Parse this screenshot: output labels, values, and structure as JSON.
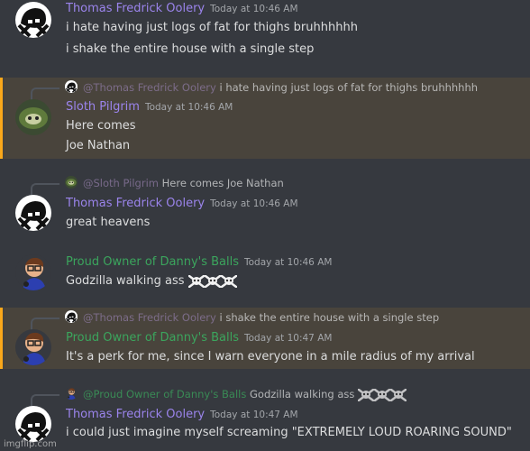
{
  "colors": {
    "background": "#36393f",
    "mention_bg": "#49443c",
    "mention_bar": "#faa81a",
    "thomas": "#9b84ec",
    "proud": "#3ba55d",
    "sloth": "#9b84ec"
  },
  "messages": [
    {
      "author": "Thomas Fredrick Oolery",
      "timestamp": "Today at 10:46 AM",
      "lines": [
        "i hate having just logs of fat for thighs bruhhhhhh",
        "i shake the entire house with a single step"
      ]
    },
    {
      "reply_to": {
        "author": "@Thomas Fredrick Oolery",
        "text": "i hate having just logs of fat for thighs bruhhhhhh"
      },
      "author": "Sloth Pilgrim",
      "timestamp": "Today at 10:46 AM",
      "lines": [
        "Here comes",
        "Joe Nathan"
      ]
    },
    {
      "reply_to": {
        "author": "@Sloth Pilgrim",
        "text": "Here comes Joe Nathan"
      },
      "author": "Thomas Fredrick Oolery",
      "timestamp": "Today at 10:46 AM",
      "lines": [
        "great heavens"
      ]
    },
    {
      "author": "Proud Owner of Danny's Balls",
      "timestamp": "Today at 10:46 AM",
      "lines": [
        "Godzilla walking ass"
      ],
      "emoji": [
        "skull-and-crossbones",
        "skull-and-crossbones",
        "skull-and-crossbones"
      ]
    },
    {
      "reply_to": {
        "author": "@Thomas Fredrick Oolery",
        "text": "i shake the entire house with a single step"
      },
      "author": "Proud Owner of Danny's Balls",
      "timestamp": "Today at 10:47 AM",
      "lines": [
        "It's a perk for me, since I warn everyone in a mile radius of my arrival"
      ]
    },
    {
      "reply_to": {
        "author": "@Proud Owner of Danny's Balls",
        "text": "Godzilla walking ass",
        "emoji": [
          "skull-and-crossbones",
          "skull-and-crossbones",
          "skull-and-crossbones"
        ]
      },
      "author": "Thomas Fredrick Oolery",
      "timestamp": "Today at 10:47 AM",
      "lines": [
        "i could just imagine myself screaming \"EXTREMELY LOUD ROARING SOUND\""
      ]
    }
  ],
  "watermark": "imgflip.com"
}
